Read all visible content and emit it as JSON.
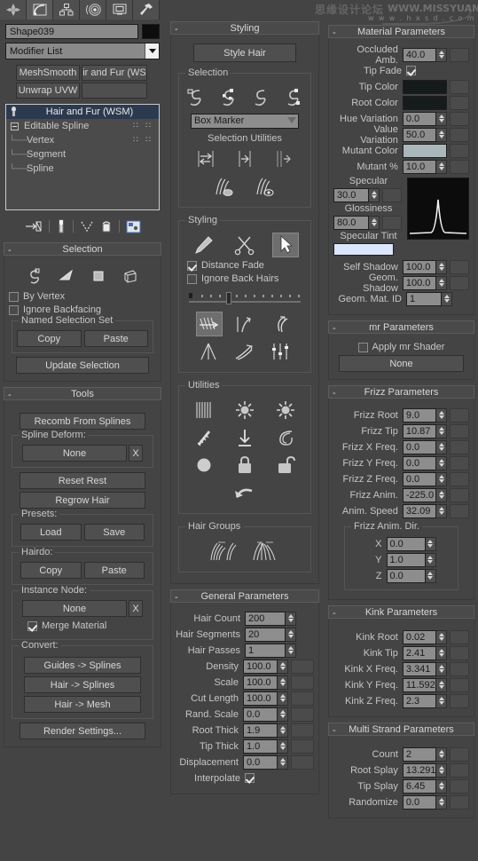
{
  "toolbar": {
    "buttons": [
      {
        "name": "create-tab-icon",
        "title": "Create"
      },
      {
        "name": "modify-tab-icon",
        "title": "Modify"
      },
      {
        "name": "hierarchy-tab-icon",
        "title": "Hierarchy"
      },
      {
        "name": "motion-tab-icon",
        "title": "Motion"
      },
      {
        "name": "display-tab-icon",
        "title": "Display"
      },
      {
        "name": "utilities-tab-icon",
        "title": "Utilities"
      }
    ]
  },
  "watermark": {
    "cn_text": "思缘设计论坛",
    "url_main": "WWW.MISSYUAN.COM",
    "url_sub": "w w w . h x s d . c o m"
  },
  "object": {
    "name_value": "Shape039",
    "color": "#0d0d0d"
  },
  "modifier_list": {
    "label": "Modifier List",
    "buttons": [
      [
        "MeshSmooth",
        "ir and Fur (WS"
      ],
      [
        "Unwrap UVW",
        ""
      ]
    ],
    "stack": [
      {
        "label": "Hair and Fur (WSM)",
        "selected": true,
        "icon": "lightbulb-icon",
        "dots": false
      },
      {
        "label": "Editable Spline",
        "selected": false,
        "icon": "expand-box-icon",
        "dots": true
      },
      {
        "label": "Vertex",
        "selected": false,
        "icon": "tree-branch-icon",
        "dots": true
      },
      {
        "label": "Segment",
        "selected": false,
        "icon": "tree-branch-icon",
        "dots": false
      },
      {
        "label": "Spline",
        "selected": false,
        "icon": "tree-branch-icon",
        "dots": false
      }
    ],
    "stack_tools": [
      "pin-stack-icon",
      "show-end-result-icon",
      "make-unique-icon",
      "remove-modifier-icon",
      "configure-modifier-sets-icon"
    ]
  },
  "selection_rollout": {
    "title": "Selection",
    "mode_icons": [
      "guides-by-ends-icon",
      "guides-by-root-icon",
      "guide-vertices-icon",
      "guides-icon"
    ],
    "by_vertex": {
      "label": "By Vertex",
      "checked": false
    },
    "ignore_backfacing": {
      "label": "Ignore Backfacing",
      "checked": false
    },
    "named_selection_set": {
      "title": "Named Selection Set",
      "copy": "Copy",
      "paste": "Paste"
    },
    "update_selection": "Update Selection"
  },
  "tools_rollout": {
    "title": "Tools",
    "recomb_from_splines": "Recomb From Splines",
    "spline_deform": {
      "title": "Spline Deform:",
      "value": "None",
      "clear": "X"
    },
    "reset_rest": "Reset Rest",
    "regrow_hair": "Regrow Hair",
    "presets": {
      "title": "Presets:",
      "load": "Load",
      "save": "Save"
    },
    "hairdo": {
      "title": "Hairdo:",
      "copy": "Copy",
      "paste": "Paste"
    },
    "instance_node": {
      "title": "Instance Node:",
      "value": "None",
      "clear": "X",
      "merge_material": {
        "label": "Merge Material",
        "checked": true
      }
    },
    "convert": {
      "title": "Convert:",
      "guides_to_splines": "Guides -> Splines",
      "hair_to_splines": "Hair -> Splines",
      "hair_to_mesh": "Hair -> Mesh"
    },
    "render_settings": "Render Settings..."
  },
  "styling_rollout": {
    "title": "Styling",
    "style_hair": "Style Hair",
    "selection_group": {
      "title": "Selection",
      "icons": [
        "select-hair-by-ends-icon",
        "select-whole-guide-icon",
        "select-guide-vertices-icon",
        "select-guide-by-root-icon"
      ],
      "marker_dropdown": "Box Marker",
      "utilities_label": "Selection Utilities",
      "utility_icons": [
        "invert-selection-icon",
        "rotate-selection-icon",
        "expand-selection-icon",
        "hide-selected-icon",
        "show-hidden-icon"
      ]
    },
    "styling_group": {
      "title": "Styling",
      "tool_icons": [
        "hairbrush-icon",
        "scissors-icon",
        "select-arrow-icon"
      ],
      "distance_fade": {
        "label": "Distance Fade",
        "checked": true
      },
      "ignore_back_hairs": {
        "label": "Ignore Back Hairs",
        "checked": false
      },
      "brush_size_slider": {
        "value": 22
      },
      "brush_icons": [
        "comb-brush-icon",
        "stand-brush-icon",
        "puff-brush-icon",
        "clump-brush-icon",
        "curl-brush-icon",
        "scale-brush-icon"
      ]
    },
    "utilities_group": {
      "title": "Utilities",
      "icons": [
        "hair-straighten-icon",
        "pop-zero-size-icon",
        "pop-selected-icon",
        "recomb-icon",
        "reset-rest-icon",
        "toggle-collision-icon",
        "toggle-hair-icon",
        "lock-icon",
        "unlock-icon",
        "undo-icon"
      ]
    },
    "hair_groups": {
      "title": "Hair Groups",
      "icons": [
        "split-hair-group-icon",
        "merge-hair-group-icon"
      ]
    }
  },
  "general_parameters": {
    "title": "General Parameters",
    "fields": [
      {
        "label": "Hair Count",
        "value": "200",
        "wide": true
      },
      {
        "label": "Hair Segments",
        "value": "20",
        "wide": true
      },
      {
        "label": "Hair Passes",
        "value": "1",
        "wide": true
      },
      {
        "label": "Density",
        "value": "100.0",
        "wide": false
      },
      {
        "label": "Scale",
        "value": "100.0",
        "wide": false
      },
      {
        "label": "Cut Length",
        "value": "100.0",
        "wide": false
      },
      {
        "label": "Rand. Scale",
        "value": "0.0",
        "wide": false
      },
      {
        "label": "Root Thick",
        "value": "1.9",
        "wide": false
      },
      {
        "label": "Tip Thick",
        "value": "1.0",
        "wide": false
      },
      {
        "label": "Displacement",
        "value": "0.0",
        "wide": false
      }
    ],
    "interpolate": {
      "label": "Interpolate",
      "checked": true
    }
  },
  "material_parameters": {
    "title": "Material Parameters",
    "occluded_amb": {
      "label": "Occluded Amb.",
      "value": "40.0"
    },
    "tip_fade": {
      "label": "Tip Fade",
      "checked": true
    },
    "tip_color": {
      "label": "Tip Color",
      "color": "#151a1a"
    },
    "root_color": {
      "label": "Root Color",
      "color": "#161c1c"
    },
    "hue_variation": {
      "label": "Hue Variation",
      "value": "0.0"
    },
    "value_variation": {
      "label": "Value Variation",
      "value": "50.0"
    },
    "mutant_color": {
      "label": "Mutant Color",
      "color": "#aab8bc"
    },
    "mutant_pct": {
      "label": "Mutant %",
      "value": "10.0"
    },
    "specular": {
      "label": "Specular",
      "value": "30.0"
    },
    "glossiness": {
      "label": "Glossiness",
      "value": "80.0"
    },
    "specular_tint": {
      "label": "Specular Tint",
      "color": "#dbe6fa"
    },
    "self_shadow": {
      "label": "Self Shadow",
      "value": "100.0"
    },
    "geom_shadow": {
      "label": "Geom. Shadow",
      "value": "100.0"
    },
    "geom_mat_id": {
      "label": "Geom. Mat. ID",
      "value": "1"
    }
  },
  "mr_parameters": {
    "title": "mr Parameters",
    "apply_mr_shader": {
      "label": "Apply mr Shader",
      "checked": false
    },
    "shader_button": "None"
  },
  "frizz_parameters": {
    "title": "Frizz Parameters",
    "fields": [
      {
        "label": "Frizz Root",
        "value": "9.0"
      },
      {
        "label": "Frizz Tip",
        "value": "10.87"
      },
      {
        "label": "Frizz X Freq.",
        "value": "0.0"
      },
      {
        "label": "Frizz Y Freq.",
        "value": "0.0"
      },
      {
        "label": "Frizz Z Freq.",
        "value": "0.0"
      },
      {
        "label": "Frizz Anim.",
        "value": "-225.0"
      },
      {
        "label": "Anim. Speed",
        "value": "32.09"
      }
    ],
    "anim_dir": {
      "title": "Frizz Anim. Dir.",
      "axes": [
        {
          "label": "X",
          "value": "0.0"
        },
        {
          "label": "Y",
          "value": "1.0"
        },
        {
          "label": "Z",
          "value": "0.0"
        }
      ]
    }
  },
  "kink_parameters": {
    "title": "Kink Parameters",
    "fields": [
      {
        "label": "Kink Root",
        "value": "0.02"
      },
      {
        "label": "Kink Tip",
        "value": "2.41"
      },
      {
        "label": "Kink X Freq.",
        "value": "3.341"
      },
      {
        "label": "Kink Y Freq.",
        "value": "11.592"
      },
      {
        "label": "Kink Z Freq.",
        "value": "2.3"
      }
    ]
  },
  "multi_strand_parameters": {
    "title": "Multi Strand Parameters",
    "fields": [
      {
        "label": "Count",
        "value": "2"
      },
      {
        "label": "Root Splay",
        "value": "13.291"
      },
      {
        "label": "Tip Splay",
        "value": "6.45"
      },
      {
        "label": "Randomize",
        "value": "0.0"
      }
    ]
  }
}
